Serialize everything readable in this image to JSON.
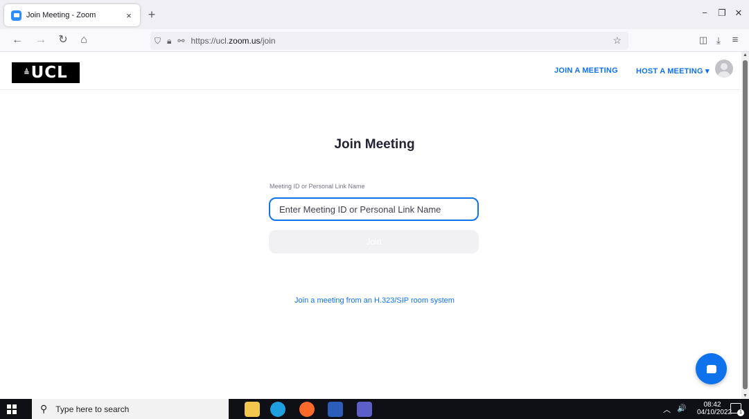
{
  "browser": {
    "tab": {
      "title": "Join Meeting - Zoom",
      "close_glyph": "×"
    },
    "new_tab_glyph": "+",
    "window": {
      "minimize_glyph": "−",
      "restore_glyph": "❐",
      "close_glyph": "✕"
    },
    "nav": {
      "back_glyph": "←",
      "forward_glyph": "→",
      "reload_glyph": "↻",
      "home_glyph": "⌂"
    },
    "url": {
      "prefix": "https://ucl.",
      "domain": "zoom.us",
      "path": "/join"
    },
    "toolbar": {
      "bookmark_glyph": "☆",
      "pocket_glyph": "◫",
      "downloads_glyph": "⤓",
      "menu_glyph": "≡"
    }
  },
  "header": {
    "logo_mark": "≜",
    "logo_text": "UCL",
    "join_link": "JOIN A MEETING",
    "host_link": "HOST A MEETING",
    "host_caret": "▾"
  },
  "main": {
    "title": "Join Meeting",
    "field_label": "Meeting ID or Personal Link Name",
    "input_placeholder": "Enter Meeting ID or Personal Link Name",
    "input_value": "",
    "join_label": "Join",
    "sip_link": "Join a meeting from an H.323/SIP room system"
  },
  "taskbar": {
    "search_placeholder": "Type here to search",
    "search_glyph": "⚲",
    "tray_caret": "︿",
    "tray_volume": "🔊",
    "time": "08:42",
    "date": "04/10/2022",
    "notification_count": "1"
  },
  "colors": {
    "accent": "#0e72ed",
    "brand_bg": "#000000",
    "taskbar": "#0f0f16"
  }
}
